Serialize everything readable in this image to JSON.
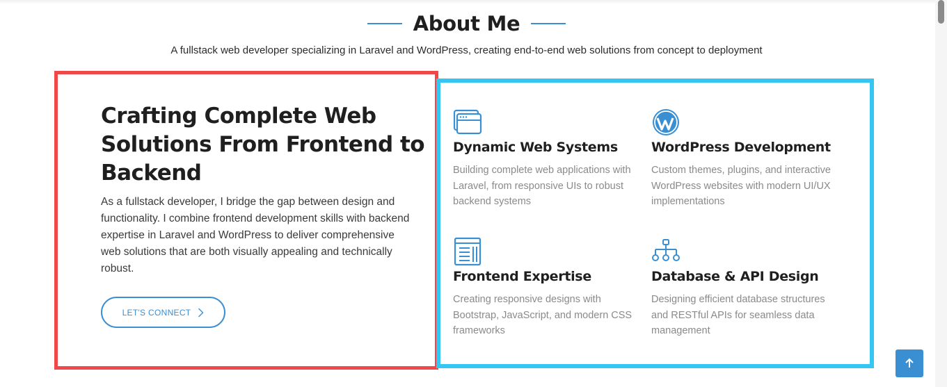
{
  "header": {
    "title": "About Me",
    "subtitle": "A fullstack web developer specializing in Laravel and WordPress, creating end-to-end web solutions from concept to deployment"
  },
  "intro": {
    "heading": "Crafting Complete Web Solutions From Frontend to Backend",
    "text": "As a fullstack developer, I bridge the gap between design and functionality. I combine frontend development skills with backend expertise in Laravel and WordPress to deliver comprehensive web solutions that are both visually appealing and technically robust.",
    "button_label": "LET'S CONNECT"
  },
  "features": [
    {
      "icon": "browser-windows-icon",
      "title": "Dynamic Web Systems",
      "text": "Building complete web applications with Laravel, from responsive UIs to robust backend systems"
    },
    {
      "icon": "wordpress-icon",
      "title": "WordPress Development",
      "text": "Custom themes, plugins, and interactive WordPress websites with modern UI/UX implementations"
    },
    {
      "icon": "layout-icon",
      "title": "Frontend Expertise",
      "text": "Creating responsive designs with Bootstrap, JavaScript, and modern CSS frameworks"
    },
    {
      "icon": "diagram-icon",
      "title": "Database & API Design",
      "text": "Designing efficient database structures and RESTful APIs for seamless data management"
    }
  ],
  "colors": {
    "accent": "#3a8fd3",
    "left_border": "#f04848",
    "right_border": "#36c6f4"
  }
}
